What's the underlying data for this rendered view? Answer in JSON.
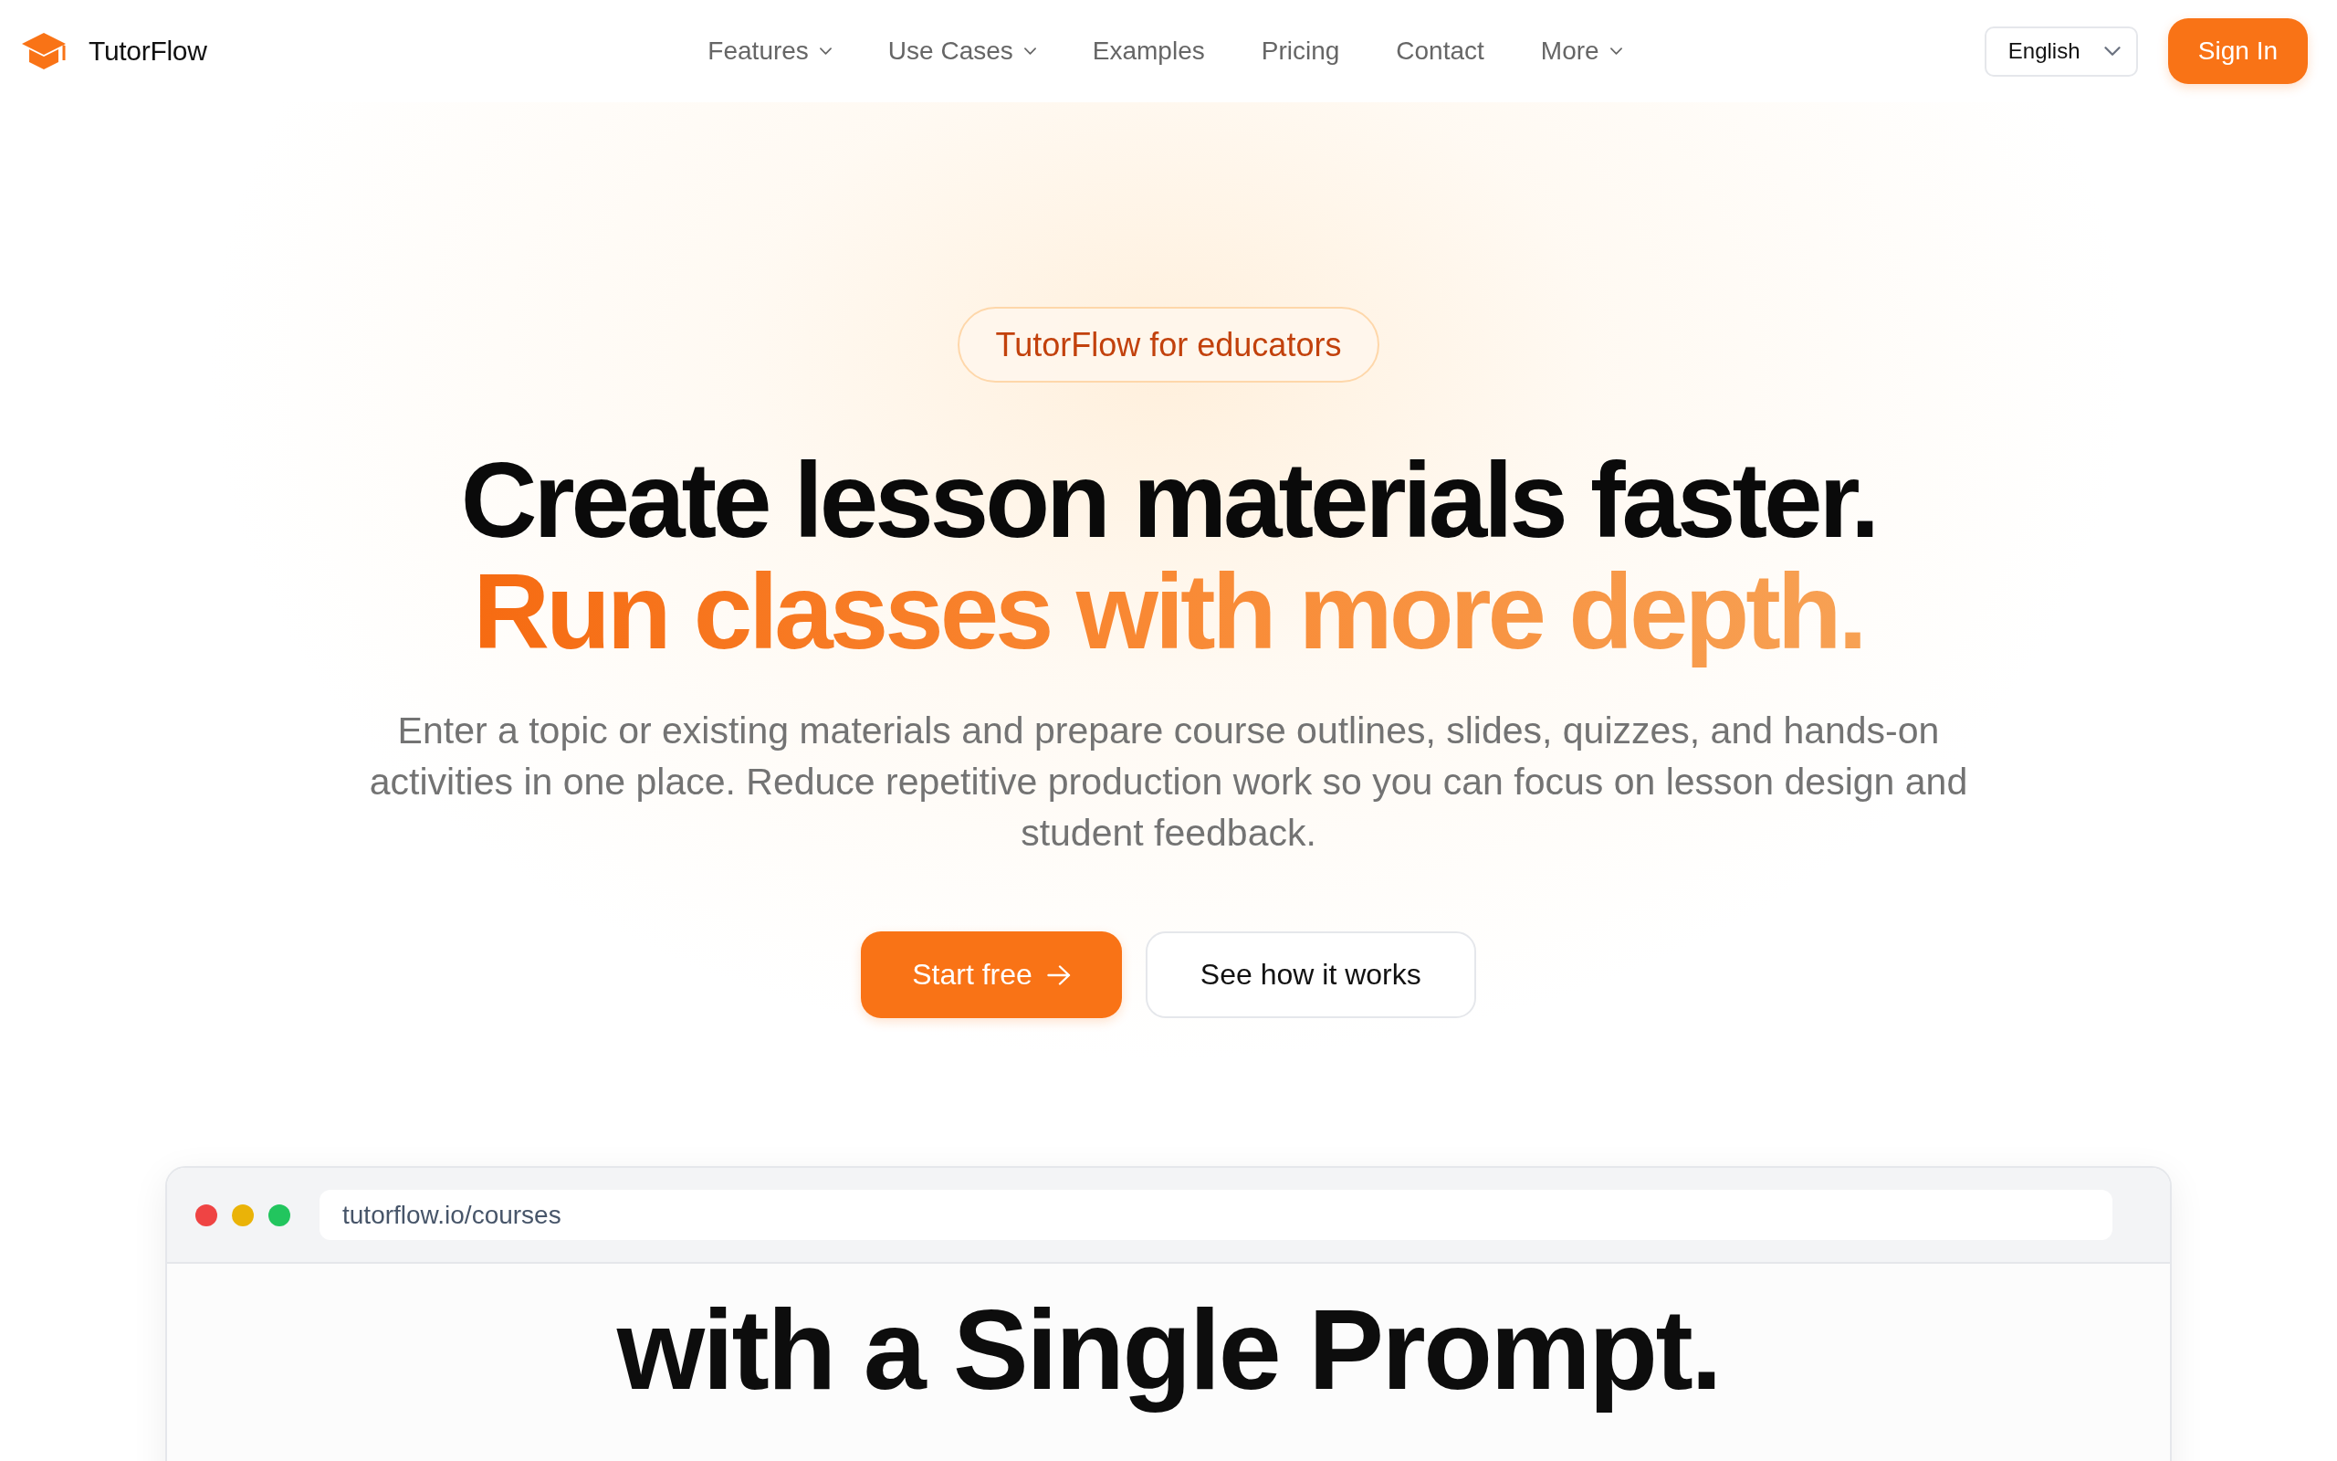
{
  "nav": {
    "brand": "TutorFlow",
    "links": [
      {
        "label": "Features",
        "kind": "dropdown"
      },
      {
        "label": "Use Cases",
        "kind": "dropdown"
      },
      {
        "label": "Examples",
        "kind": "link"
      },
      {
        "label": "Pricing",
        "kind": "link"
      },
      {
        "label": "Contact",
        "kind": "link"
      },
      {
        "label": "More",
        "kind": "dropdown"
      }
    ],
    "language": "English",
    "sign_in": "Sign In"
  },
  "hero": {
    "badge": "TutorFlow for educators",
    "headline": "Create lesson materials faster.",
    "headline_accent": "Run classes with more depth.",
    "description": "Enter a topic or existing materials and prepare course outlines, slides, quizzes, and hands-on activities in one place. Reduce repetitive production work so you can focus on lesson design and student feedback.",
    "buttons": [
      {
        "label": "Start free",
        "kind": "primary"
      },
      {
        "label": "See how it works",
        "kind": "secondary"
      }
    ]
  },
  "preview": {
    "window_dots": [
      {
        "color": "#ef4444"
      },
      {
        "color": "#eab308"
      },
      {
        "color": "#22c55e"
      }
    ],
    "url": "tutorflow.io/courses",
    "heading": "with a Single Prompt."
  }
}
